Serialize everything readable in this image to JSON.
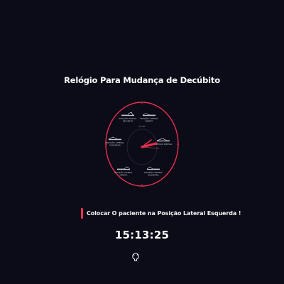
{
  "header": {
    "title": "Relógio Para Mudança de Decúbito"
  },
  "clock": {
    "face_color": "#e8304f",
    "hand_color": "#e8304f",
    "positions": [
      {
        "label_line1": "POSIÇÃO DORSAL",
        "label_line2": "DECUBITO"
      },
      {
        "label_line1": "POSIÇÃO LATERAL",
        "label_line2": "DIREITA"
      },
      {
        "label_line1": "POSIÇÃO LATERAL",
        "label_line2": "ESQUERDA"
      },
      {
        "label_line1": "POSIÇÃO DORSAL",
        "label_line2": ""
      },
      {
        "label_line1": "POSIÇÃO LATERAL",
        "label_line2": "DIREITA"
      },
      {
        "label_line1": "POSIÇÃO LATERAL",
        "label_line2": "ESQUERDA"
      }
    ]
  },
  "status": {
    "message": "Colocar O paciente na Posição Lateral Esquerda !",
    "accent_color": "#e8304f"
  },
  "time": {
    "current": "15:13:25"
  },
  "footer": {
    "icon": "github-icon"
  }
}
